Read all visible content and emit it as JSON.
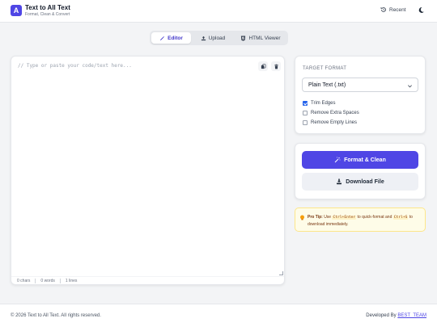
{
  "header": {
    "logo_letter": "A",
    "title": "Text to All Text",
    "subtitle": "Format, Clean & Convert",
    "recent_label": "Recent",
    "icons": [
      "history-icon",
      "moon-icon"
    ]
  },
  "tabs": [
    {
      "label": "Editor",
      "icon": "wand-icon",
      "active": true
    },
    {
      "label": "Upload",
      "icon": "upload-icon",
      "active": false
    },
    {
      "label": "HTML Viewer",
      "icon": "html5-icon",
      "active": false
    }
  ],
  "editor": {
    "placeholder": "// Type or paste your code/text here...",
    "value": "",
    "chars": "0 chars",
    "words": "0 words",
    "lines": "1 lines"
  },
  "format": {
    "section_label": "TARGET FORMAT",
    "selected": "Plain Text (.txt)",
    "options": [
      {
        "label": "Trim Edges",
        "checked": true
      },
      {
        "label": "Remove Extra Spaces",
        "checked": false
      },
      {
        "label": "Remove Empty Lines",
        "checked": false
      }
    ]
  },
  "actions": {
    "format_clean": "Format & Clean",
    "download": "Download File"
  },
  "tip": {
    "title": "Pro Tip:",
    "text1": "Use",
    "key1": "Ctrl+Enter",
    "text2": "to quick-format and",
    "key2": "Ctrl+S",
    "text3": "to download immediately."
  },
  "footer": {
    "copyright": "© 2026 Text to All Text. All rights reserved.",
    "developed_by": "Developed By",
    "team": "BEST_TEAM"
  },
  "colors": {
    "accent": "#4f46e5",
    "checkbox": "#2563eb",
    "tip_bg": "#fefce8"
  }
}
